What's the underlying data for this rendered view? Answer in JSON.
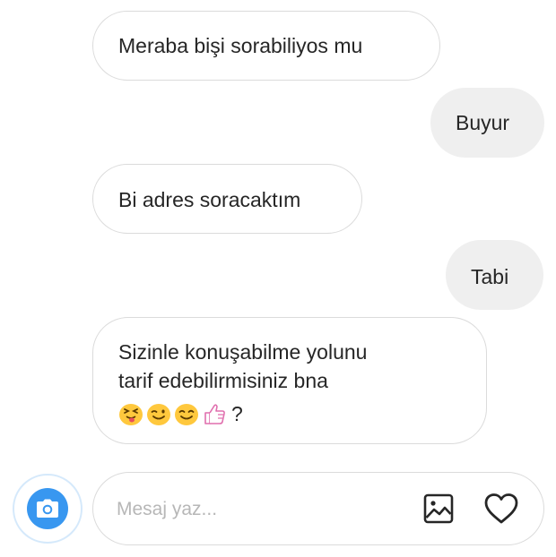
{
  "messages": [
    {
      "direction": "incoming",
      "text": "Meraba bişi sorabiliyos mu"
    },
    {
      "direction": "outgoing",
      "text": "Buyur"
    },
    {
      "direction": "incoming",
      "text": "Bi adres soracaktım"
    },
    {
      "direction": "outgoing",
      "text": "Tabi"
    },
    {
      "direction": "incoming",
      "line1": "Sizinle konuşabilme yolunu",
      "line2": "tarif edebilirmisiniz bna",
      "emojis": [
        "squinting-tongue-emoji",
        "winking-emoji",
        "smiling-emoji",
        "thumbs-up-emoji"
      ],
      "trailing": "?"
    }
  ],
  "composer": {
    "placeholder": "Mesaj yaz...",
    "value": ""
  },
  "icons": {
    "camera": "camera-icon",
    "gallery": "gallery-icon",
    "like": "heart-icon"
  },
  "colors": {
    "accent": "#3897f0",
    "outgoing_bubble": "#efefef",
    "bubble_border": "#dbdbdb",
    "emoji_yellow": "#ffc83d",
    "thumb_pink": "#e06fae"
  }
}
